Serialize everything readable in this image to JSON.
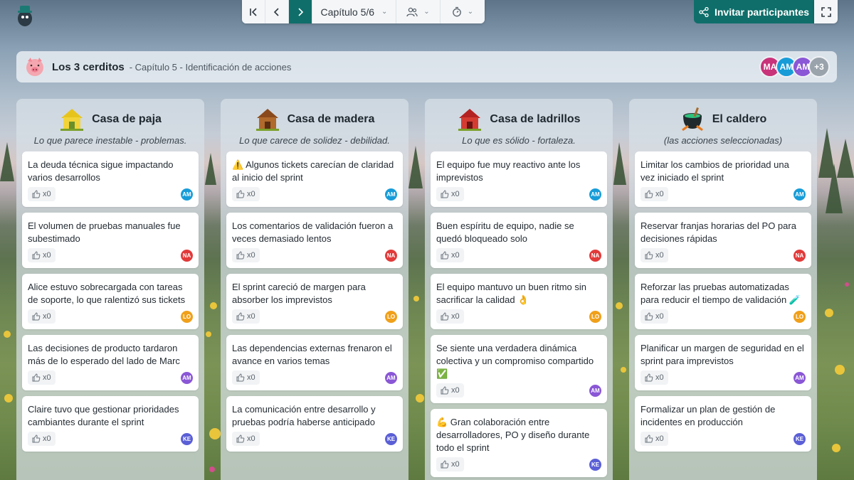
{
  "toolbar": {
    "chapter_label": "Capítulo 5/6",
    "invite_label": "Invitar participantes"
  },
  "board": {
    "title": "Los 3 cerditos",
    "subtitle": "- Capítulo 5 - Identificación de acciones",
    "participants": [
      {
        "initials": "MA",
        "color": "#c8337a"
      },
      {
        "initials": "AM",
        "color": "#179cd8"
      },
      {
        "initials": "AM",
        "color": "#8a57d6"
      },
      {
        "initials": "+3",
        "color": "#9aa3ac"
      }
    ]
  },
  "columns": [
    {
      "title": "Casa de paja",
      "subtitle": "Lo que parece inestable - problemas.",
      "icon": "straw-house-icon",
      "cards": [
        {
          "text": "La deuda técnica sigue impactando varios desarrollos",
          "likes": "x0",
          "author": "AM"
        },
        {
          "text": "El volumen de pruebas manuales fue subestimado",
          "likes": "x0",
          "author": "NA"
        },
        {
          "text": "Alice estuvo sobrecargada con tareas de soporte, lo que ralentizó sus tickets",
          "likes": "x0",
          "author": "LO"
        },
        {
          "text": "Las decisiones de producto tardaron más de lo esperado del lado de Marc",
          "likes": "x0",
          "author": "AM"
        },
        {
          "text": "Claire tuvo que gestionar prioridades cambiantes durante el sprint",
          "likes": "x0",
          "author": "KE"
        }
      ]
    },
    {
      "title": "Casa de madera",
      "subtitle": "Lo que carece de solidez - debilidad.",
      "icon": "wood-house-icon",
      "cards": [
        {
          "text": "⚠️ Algunos tickets carecían de claridad al inicio del sprint",
          "likes": "x0",
          "author": "AM"
        },
        {
          "text": "Los comentarios de validación fueron a veces demasiado lentos",
          "likes": "x0",
          "author": "NA"
        },
        {
          "text": "El sprint careció de margen para absorber los imprevistos",
          "likes": "x0",
          "author": "LO"
        },
        {
          "text": "Las dependencias externas frenaron el avance en varios temas",
          "likes": "x0",
          "author": "AM"
        },
        {
          "text": "La comunicación entre desarrollo y pruebas podría haberse anticipado",
          "likes": "x0",
          "author": "KE"
        }
      ]
    },
    {
      "title": "Casa de ladrillos",
      "subtitle": "Lo que es sólido - fortaleza.",
      "icon": "brick-house-icon",
      "cards": [
        {
          "text": "El equipo fue muy reactivo ante los imprevistos",
          "likes": "x0",
          "author": "AM"
        },
        {
          "text": "Buen espíritu de equipo, nadie se quedó bloqueado solo",
          "likes": "x0",
          "author": "NA"
        },
        {
          "text": "El equipo mantuvo un buen ritmo sin sacrificar la calidad 👌",
          "likes": "x0",
          "author": "LO"
        },
        {
          "text": "Se siente una verdadera dinámica colectiva y un compromiso compartido ✅",
          "likes": "x0",
          "author": "AM"
        },
        {
          "text": "💪 Gran colaboración entre desarrolladores, PO y diseño durante todo el sprint",
          "likes": "x0",
          "author": "KE"
        }
      ]
    },
    {
      "title": "El caldero",
      "subtitle": "(las acciones seleccionadas)",
      "icon": "cauldron-icon",
      "cards": [
        {
          "text": "Limitar los cambios de prioridad una vez iniciado el sprint",
          "likes": "x0",
          "author": "AM"
        },
        {
          "text": "Reservar franjas horarias del PO para decisiones rápidas",
          "likes": "x0",
          "author": "NA"
        },
        {
          "text": "Reforzar las pruebas automatizadas para reducir el tiempo de validación 🧪",
          "likes": "x0",
          "author": "LO"
        },
        {
          "text": "Planificar un margen de seguridad en el sprint para imprevistos",
          "likes": "x0",
          "author": "AM"
        },
        {
          "text": "Formalizar un plan de gestión de incidentes en producción",
          "likes": "x0",
          "author": "KE"
        }
      ]
    }
  ],
  "colors": {
    "accent": "#0f6e6a"
  }
}
